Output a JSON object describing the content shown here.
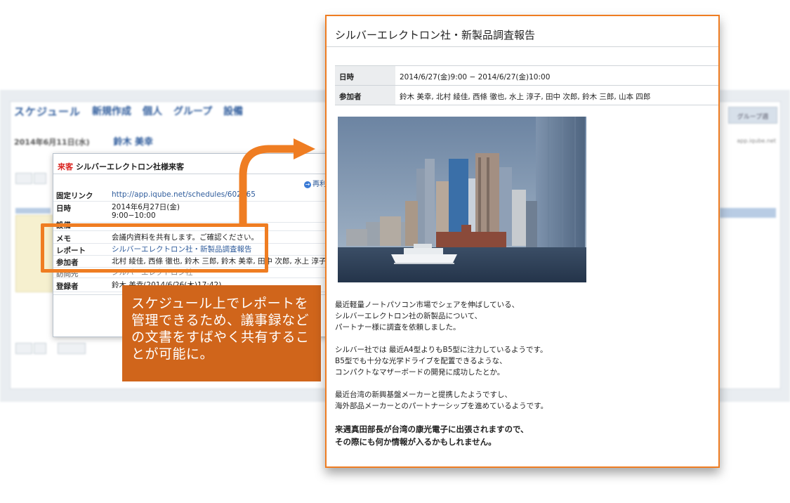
{
  "background_app": {
    "app_name": "スケジュール",
    "nav": [
      "新規作成",
      "個人",
      "グループ",
      "設備"
    ],
    "date": "2014年6月11日(水)",
    "user": "鈴木 美幸",
    "right_tab": "グループ週",
    "url": "app.iqube.net"
  },
  "popup": {
    "category": "来客",
    "title": "シルバーエレクトロン社様来客",
    "redo_label": "再利用",
    "rows": {
      "link": {
        "label": "固定リンク",
        "value": "http://app.iqube.net/schedules/602565"
      },
      "datetime": {
        "label": "日時",
        "value": "2014年6月27日(金)",
        "time": "9:00−10:00"
      },
      "facility": {
        "label": "設備",
        "value": ""
      },
      "memo": {
        "label": "メモ",
        "value": "会議内資料を共有します。ご確認ください。"
      },
      "report": {
        "label": "レポート",
        "value": "シルバーエレクトロン社・新製品調査報告"
      },
      "attendees": {
        "label": "参加者",
        "value": "北村 綾佳, 西條 徹也, 鈴木 三郎, 鈴木 美幸, 田中 次郎, 水上 淳子"
      },
      "visitor": {
        "label": "訪問先",
        "value": "シルバーエレクトロン社"
      },
      "registrant": {
        "label": "登録者",
        "value": "鈴木 美幸(2014/6/26(木)17:42)"
      }
    }
  },
  "callout": {
    "text": "スケジュール上でレポートを管理できるため、議事録などの文書をすばやく共有することが可能に。"
  },
  "report": {
    "title": "シルバーエレクトロン社・新製品調査報告",
    "table": {
      "datetime_label": "日時",
      "datetime_value": "2014/6/27(金)9:00 − 2014/6/27(金)10:00",
      "attendees_label": "参加者",
      "attendees_value": "鈴木 美幸, 北村 綾佳, 西條 徹也, 水上 淳子, 田中 次郎, 鈴木 三郎, 山本 四郎"
    },
    "paragraphs": [
      [
        "最近軽量ノートパソコン市場でシェアを伸ばしている、",
        "シルバーエレクトロン社の新製品について、",
        "パートナー様に調査を依頼しました。"
      ],
      [
        "シルバー社では 最近A4型よりもB5型に注力しているようです。",
        "B5型でも十分な光学ドライブを配置できるような、",
        "コンパクトなマザーボードの開発に成功したとか。"
      ],
      [
        "最近台湾の新興基盤メーカーと提携したようですし、",
        "海外部品メーカーとのパートナーシップを進めているようです。"
      ],
      [
        "来週真田部長が台湾の康光電子に出張されますので、",
        "その際にも何か情報が入るかもしれません。"
      ]
    ]
  },
  "colors": {
    "accent_orange": "#ef7d22",
    "callout_bg": "#d0651b",
    "link_blue": "#2f5c9c",
    "category_red": "#d9231f"
  }
}
